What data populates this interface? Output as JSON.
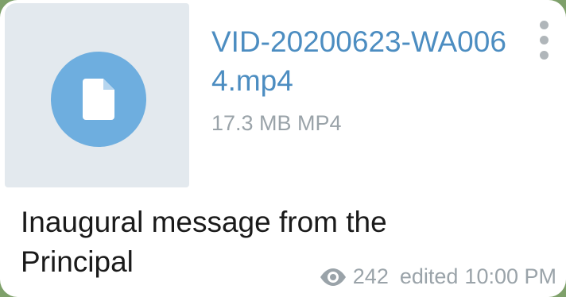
{
  "message": {
    "attachment": {
      "file_name": "VID-20200623-WA0064.mp4",
      "file_info": "17.3 MB MP4",
      "icon": "file-icon"
    },
    "menu_icon": "more-vertical-icon",
    "caption": "Inaugural message from the Principal",
    "views_icon": "eye-icon",
    "views": "242",
    "edited_label": "edited",
    "time": "10:00 PM"
  },
  "colors": {
    "file_name": "#4c8dc1",
    "file_icon_bg": "#6eaedf",
    "thumb_bg": "#e3e9ee",
    "meta_text": "#9aa3a9",
    "caption_text": "#1a1a1a",
    "bubble_bg": "#ffffff"
  }
}
